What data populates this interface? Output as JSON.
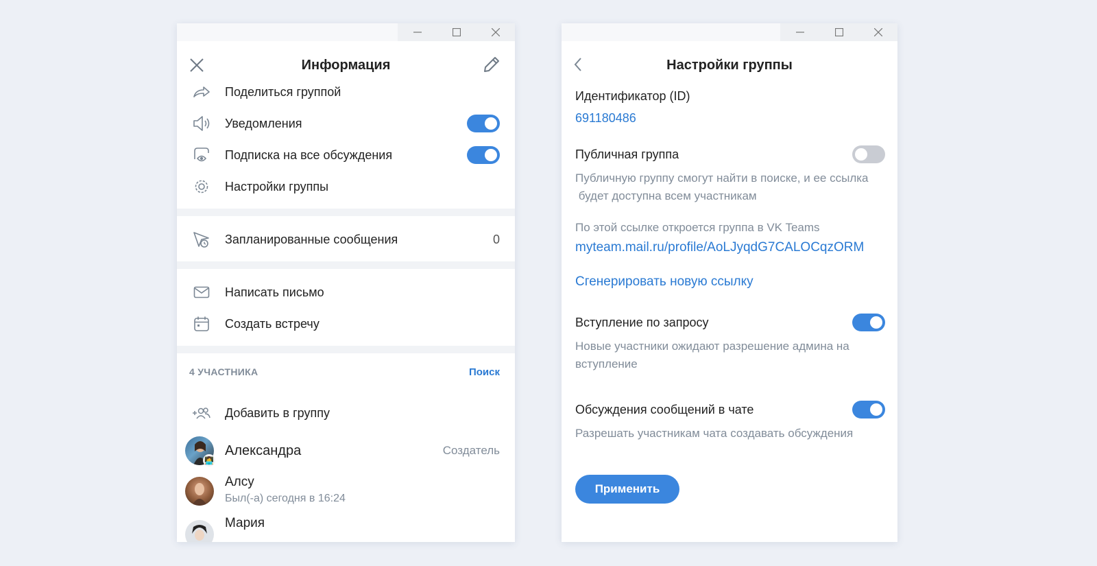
{
  "left": {
    "title": "Информация",
    "menu": [
      {
        "label": "Поделиться группой",
        "icon": "share-icon"
      },
      {
        "label": "Уведомления",
        "icon": "speaker-icon",
        "toggle": true
      },
      {
        "label": "Подписка на все обсуждения",
        "icon": "discussion-eye-icon",
        "toggle": true
      },
      {
        "label": "Настройки группы",
        "icon": "gear-icon"
      }
    ],
    "scheduled": {
      "label": "Запланированные сообщения",
      "count": "0"
    },
    "actions": [
      {
        "label": "Написать письмо",
        "icon": "envelope-icon"
      },
      {
        "label": "Создать встречу",
        "icon": "calendar-icon"
      }
    ],
    "members": {
      "header": "4 УЧАСТНИКА",
      "search": "Поиск",
      "add": "Добавить в группу",
      "list": [
        {
          "name": "Александра",
          "role": "Создатель"
        },
        {
          "name": "Алсу",
          "status": "Был(-а) сегодня в 16:24"
        },
        {
          "name": "Мария"
        }
      ]
    }
  },
  "right": {
    "title": "Настройки группы",
    "id_label": "Идентификатор (ID)",
    "id_value": "691180486",
    "public": {
      "label": "Публичная группа",
      "enabled": false,
      "desc_line1": "Публичную группу смогут найти в поиске, и ее ссылка",
      "desc_line2": " будет доступна всем участникам"
    },
    "link_label": "По этой ссылке откроется группа в VK Teams",
    "link_url": "myteam.mail.ru/profile/AoLJyqdG7CALOCqzORM",
    "regenerate": "Сгенерировать новую ссылку",
    "join_request": {
      "label": "Вступление по запросу",
      "enabled": true,
      "desc_line1": "Новые участники ожидают разрешение админа на",
      "desc_line2": "вступление"
    },
    "discussions": {
      "label": "Обсуждения сообщений в чате",
      "enabled": true,
      "desc": "Разрешать участникам чата создавать обсуждения"
    },
    "apply": "Применить"
  },
  "colors": {
    "accent": "#3b86de",
    "link": "#2a7ad3",
    "muted": "#818c99",
    "background": "#edf0f6"
  }
}
